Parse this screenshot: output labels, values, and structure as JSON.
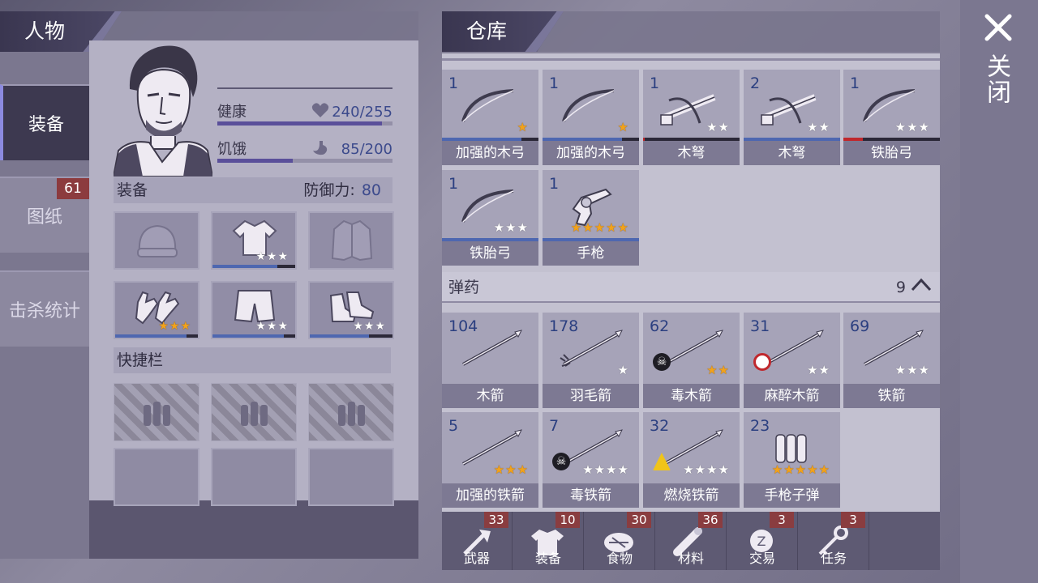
{
  "left_panel": {
    "title": "人物",
    "tabs": [
      {
        "label": "装备",
        "badge": ""
      },
      {
        "label": "图纸",
        "badge": "61"
      },
      {
        "label": "击杀统计",
        "badge": ""
      }
    ],
    "stats": {
      "health_label": "健康",
      "health_value": "240/255",
      "health_fraction": 0.94,
      "hunger_label": "饥饿",
      "hunger_value": "85/200",
      "hunger_fraction": 0.43
    },
    "equipment_label": "装备",
    "defense_label": "防御力:",
    "defense_value": "80",
    "quickbar_label": "快捷栏"
  },
  "storage": {
    "title": "仓库",
    "weapons": [
      {
        "qty": "1",
        "name": "加强的木弓",
        "stars": 1,
        "star_color": "gold",
        "durability": 0.82
      },
      {
        "qty": "1",
        "name": "加强的木弓",
        "stars": 1,
        "star_color": "gold",
        "durability": 0.82
      },
      {
        "qty": "1",
        "name": "木弩",
        "stars": 2,
        "star_color": "white",
        "durability": 0.02
      },
      {
        "qty": "2",
        "name": "木弩",
        "stars": 2,
        "star_color": "white",
        "durability": 1.0
      },
      {
        "qty": "1",
        "name": "铁胎弓",
        "stars": 3,
        "star_color": "white",
        "durability": 0.2
      },
      {
        "qty": "1",
        "name": "铁胎弓",
        "stars": 3,
        "star_color": "white",
        "durability": 1.0
      },
      {
        "qty": "1",
        "name": "手枪",
        "stars": 5,
        "star_color": "gold",
        "durability": 1.0
      }
    ],
    "ammo_label": "弹药",
    "ammo_count": "9",
    "ammo": [
      {
        "qty": "104",
        "name": "木箭",
        "stars": 0,
        "star_color": "white"
      },
      {
        "qty": "178",
        "name": "羽毛箭",
        "stars": 1,
        "star_color": "white"
      },
      {
        "qty": "62",
        "name": "毒木箭",
        "stars": 2,
        "star_color": "gold"
      },
      {
        "qty": "31",
        "name": "麻醉木箭",
        "stars": 2,
        "star_color": "white"
      },
      {
        "qty": "69",
        "name": "铁箭",
        "stars": 3,
        "star_color": "white"
      },
      {
        "qty": "5",
        "name": "加强的铁箭",
        "stars": 3,
        "star_color": "gold"
      },
      {
        "qty": "7",
        "name": "毒铁箭",
        "stars": 4,
        "star_color": "white"
      },
      {
        "qty": "32",
        "name": "燃烧铁箭",
        "stars": 4,
        "star_color": "white"
      },
      {
        "qty": "23",
        "name": "手枪子弹",
        "stars": 5,
        "star_color": "gold"
      }
    ],
    "categories": [
      {
        "label": "武器",
        "badge": "33",
        "icon": "axe-icon"
      },
      {
        "label": "装备",
        "badge": "10",
        "icon": "shirt-icon"
      },
      {
        "label": "食物",
        "badge": "30",
        "icon": "meat-icon"
      },
      {
        "label": "材料",
        "badge": "36",
        "icon": "log-icon"
      },
      {
        "label": "交易",
        "badge": "3",
        "icon": "coin-icon"
      },
      {
        "label": "任务",
        "badge": "3",
        "icon": "key-icon"
      }
    ]
  },
  "close": {
    "label": "关闭",
    "icon": "close-icon"
  },
  "equipment_slots": [
    {
      "icon": "beanie-icon",
      "stars": 0,
      "star_color": "white",
      "durability": 0
    },
    {
      "icon": "shirt-icon",
      "stars": 3,
      "star_color": "white",
      "durability": 0.78
    },
    {
      "icon": "jacket-icon",
      "stars": 0,
      "star_color": "white",
      "durability": 0
    },
    {
      "icon": "gloves-icon",
      "stars": 3,
      "star_color": "gold",
      "durability": 0.86
    },
    {
      "icon": "shorts-icon",
      "stars": 3,
      "star_color": "white",
      "durability": 0.86
    },
    {
      "icon": "shoes-icon",
      "stars": 3,
      "star_color": "white",
      "durability": 0.72
    }
  ]
}
